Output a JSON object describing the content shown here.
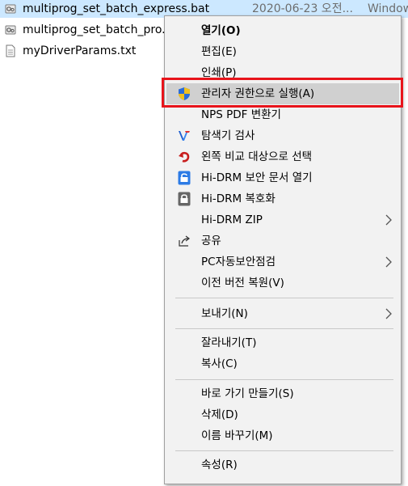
{
  "files": [
    {
      "name": "multiprog_set_batch_express.bat",
      "date": "2020-06-23 오전...",
      "type": "Window",
      "icon": "batch-file-icon",
      "selected": true
    },
    {
      "name": "multiprog_set_batch_pro.bat",
      "icon": "batch-file-icon",
      "selected": false
    },
    {
      "name": "myDriverParams.txt",
      "icon": "text-file-icon",
      "selected": false
    }
  ],
  "menu": {
    "items": [
      {
        "label": "열기(O)",
        "bold": true
      },
      {
        "label": "편집(E)"
      },
      {
        "label": "인쇄(P)"
      },
      {
        "label": "관리자 권한으로 실행(A)",
        "icon": "uac-shield-icon",
        "highlighted": true
      },
      {
        "label": "NPS PDF 변환기"
      },
      {
        "label": "탐색기 검사",
        "icon": "antivirus-v-icon"
      },
      {
        "label": "왼쪽 비교 대상으로 선택",
        "icon": "compare-arrow-icon"
      },
      {
        "label": "Hi-DRM 보안 문서 열기",
        "icon": "drm-lock-open-icon"
      },
      {
        "label": "Hi-DRM 복호화",
        "icon": "drm-lock-icon"
      },
      {
        "label": "Hi-DRM ZIP",
        "submenu": true
      },
      {
        "label": "공유",
        "icon": "share-icon"
      },
      {
        "label": "PC자동보안점검",
        "submenu": true
      },
      {
        "label": "이전 버전 복원(V)"
      },
      {
        "label": "보내기(N)",
        "submenu": true
      },
      {
        "label": "잘라내기(T)"
      },
      {
        "label": "복사(C)"
      },
      {
        "label": "바로 가기 만들기(S)"
      },
      {
        "label": "삭제(D)"
      },
      {
        "label": "이름 바꾸기(M)"
      },
      {
        "label": "속성(R)"
      }
    ]
  },
  "colors": {
    "highlight_border": "#e8141b",
    "selection": "#cce8ff",
    "menu_bg": "#f2f2f2"
  }
}
